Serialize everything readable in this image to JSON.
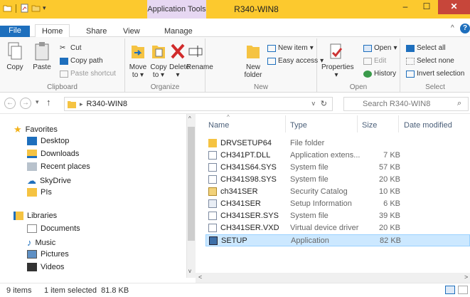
{
  "window": {
    "title": "R340-WIN8",
    "context_tab": "Application Tools",
    "min_icon": "minimize-icon",
    "max_icon": "maximize-icon",
    "close_icon": "close-icon"
  },
  "tabs": [
    {
      "label": "File",
      "active": false
    },
    {
      "label": "Home",
      "active": true
    },
    {
      "label": "Share",
      "active": false
    },
    {
      "label": "View",
      "active": false
    },
    {
      "label": "Manage",
      "active": false
    }
  ],
  "ribbon": {
    "clipboard": {
      "label": "Clipboard",
      "copy": "Copy",
      "paste": "Paste",
      "cut": "Cut",
      "copy_path": "Copy path",
      "paste_shortcut": "Paste shortcut"
    },
    "organize": {
      "label": "Organize",
      "move_to": "Move to",
      "copy_to": "Copy to",
      "delete": "Delete",
      "rename": "Rename"
    },
    "new": {
      "label": "New",
      "new_folder": "New folder",
      "new_item": "New item",
      "easy_access": "Easy access"
    },
    "open": {
      "label": "Open",
      "properties": "Properties",
      "open": "Open",
      "edit": "Edit",
      "history": "History"
    },
    "select": {
      "label": "Select",
      "select_all": "Select all",
      "select_none": "Select none",
      "invert": "Invert selection"
    }
  },
  "address": {
    "path": "R340-WIN8",
    "search_placeholder": "Search R340-WIN8"
  },
  "nav": {
    "favorites": "Favorites",
    "favorite_items": [
      "Desktop",
      "Downloads",
      "Recent places",
      "SkyDrive",
      "PIs"
    ],
    "libraries": "Libraries",
    "library_items": [
      "Documents",
      "Music",
      "Pictures",
      "Videos"
    ]
  },
  "columns": {
    "name": "Name",
    "type": "Type",
    "size": "Size",
    "date": "Date modified"
  },
  "files": [
    {
      "name": "DRVSETUP64",
      "type": "File folder",
      "size": "",
      "icon": "folder-icon"
    },
    {
      "name": "CH341PT.DLL",
      "type": "Application extens...",
      "size": "7 KB",
      "icon": "dll-file-icon"
    },
    {
      "name": "CH341S64.SYS",
      "type": "System file",
      "size": "57 KB",
      "icon": "system-file-icon"
    },
    {
      "name": "CH341S98.SYS",
      "type": "System file",
      "size": "20 KB",
      "icon": "system-file-icon"
    },
    {
      "name": "ch341SER",
      "type": "Security Catalog",
      "size": "10 KB",
      "icon": "catalog-file-icon"
    },
    {
      "name": "CH341SER",
      "type": "Setup Information",
      "size": "6 KB",
      "icon": "inf-file-icon"
    },
    {
      "name": "CH341SER.SYS",
      "type": "System file",
      "size": "39 KB",
      "icon": "system-file-icon"
    },
    {
      "name": "CH341SER.VXD",
      "type": "Virtual device driver",
      "size": "20 KB",
      "icon": "system-file-icon"
    },
    {
      "name": "SETUP",
      "type": "Application",
      "size": "82 KB",
      "icon": "setup-app-icon",
      "selected": true
    }
  ],
  "status": {
    "count": "9 items",
    "selection": "1 item selected  81.8 KB"
  },
  "colors": {
    "accent": "#1e6fbd",
    "title_bar": "#fcc92e",
    "selection": "#cce8ff",
    "close": "#c7463a"
  }
}
